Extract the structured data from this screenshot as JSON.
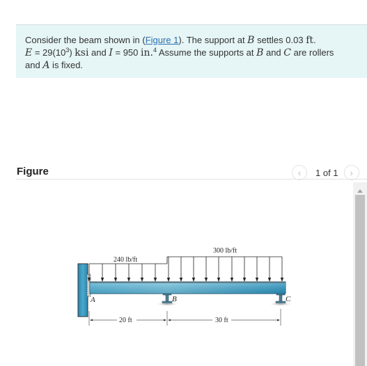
{
  "problem": {
    "line1_pre": "Consider the beam shown in (",
    "figure_link": "Figure 1",
    "line1_post": "). The support at ",
    "var_B": "B",
    "settles_text": " settles 0.03 ",
    "unit_ft": "ft",
    "period": ".",
    "var_E": "E",
    "e_eq": " = 29(10",
    "e_exp": "3",
    "e_close": ") ",
    "unit_ksi": "ksi",
    "and1": " and ",
    "var_I": "I",
    "i_eq": " = 950 ",
    "unit_in": "in.",
    "i_exp": "4",
    "assume": " Assume the supports at ",
    "var_B2": "B",
    "and2": " and ",
    "var_C": "C",
    "rollers": " are rollers",
    "and3": "and ",
    "var_A": "A",
    "fixed": " is fixed."
  },
  "figure_header": {
    "title": "Figure",
    "pager_text": "1 of 1",
    "prev_icon": "chevron-left-icon",
    "next_icon": "chevron-right-icon"
  },
  "diagram": {
    "load_left": "240 lb/ft",
    "load_right": "300 lb/ft",
    "label_A": "A",
    "label_B": "B",
    "label_C": "C",
    "dim_left": "20 ft",
    "dim_right": "30 ft",
    "colors": {
      "beam": "#3a9fc4",
      "beam_dark": "#1e7fa5",
      "wall": "#2f8fb6",
      "support": "#4a7f95"
    }
  }
}
